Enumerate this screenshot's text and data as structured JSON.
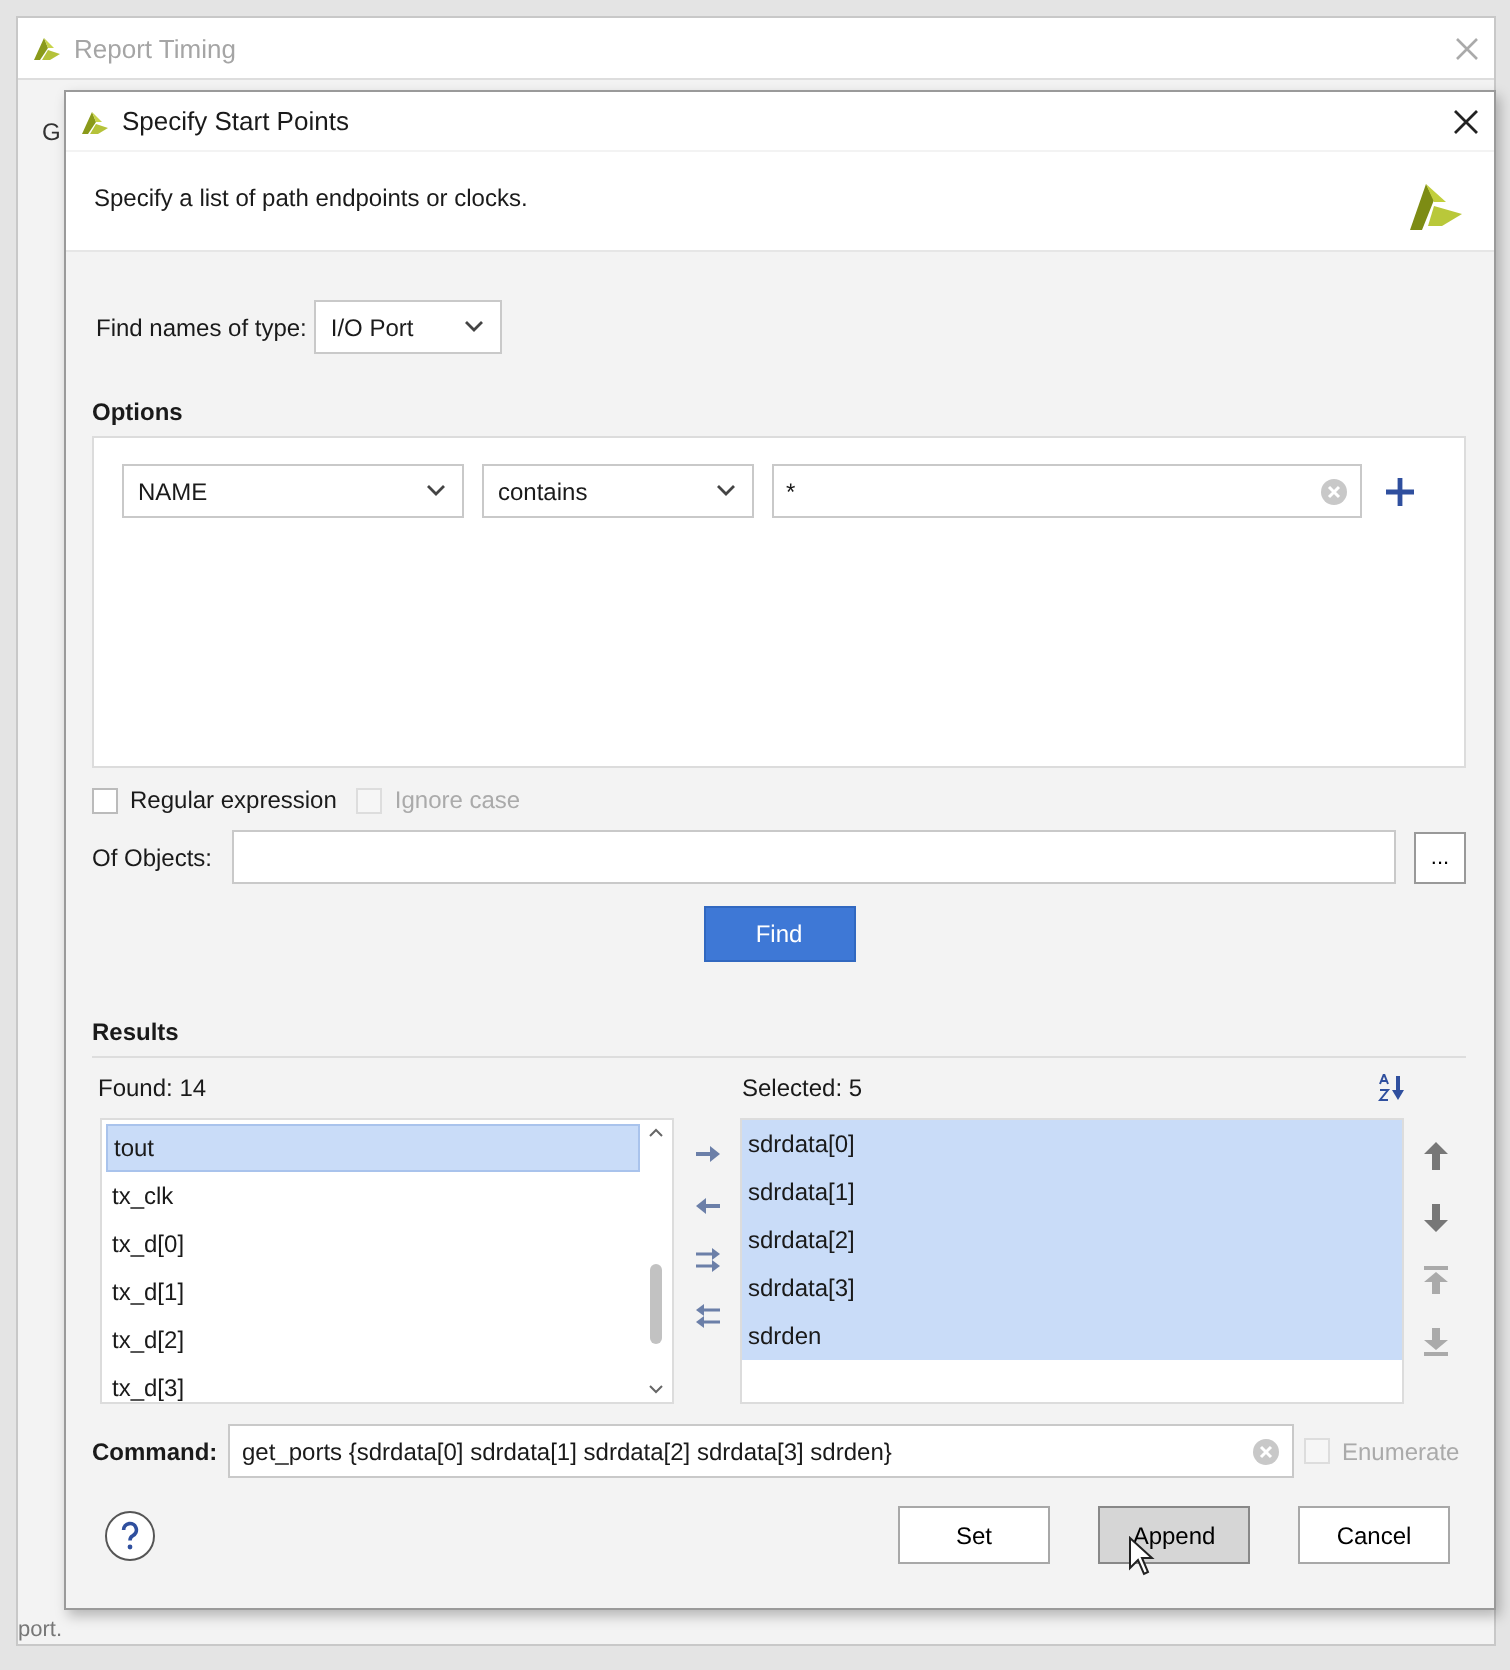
{
  "background_window": {
    "title": "Report Timing",
    "label": "G",
    "footer": "port."
  },
  "dialog": {
    "title": "Specify Start Points",
    "description": "Specify a list of path endpoints or clocks."
  },
  "find_type": {
    "label": "Find names of type:",
    "value": "I/O Port"
  },
  "options": {
    "heading": "Options",
    "filters": [
      {
        "property": "NAME",
        "operator": "contains",
        "value": "*"
      }
    ]
  },
  "checkboxes": [
    {
      "label": "Regular expression",
      "checked": false,
      "disabled": false
    },
    {
      "label": "Ignore case",
      "checked": false,
      "disabled": true
    }
  ],
  "of_objects": {
    "label": "Of Objects:",
    "button": "..."
  },
  "find_button": "Find",
  "results": {
    "heading": "Results",
    "found_label": "Found: 14",
    "selected_label": "Selected: 5",
    "found_items": [
      {
        "label": "tout",
        "selected": true
      },
      {
        "label": "tx_clk",
        "selected": false
      },
      {
        "label": "tx_d[0]",
        "selected": false
      },
      {
        "label": "tx_d[1]",
        "selected": false
      },
      {
        "label": "tx_d[2]",
        "selected": false
      },
      {
        "label": "tx_d[3]",
        "selected": false
      }
    ],
    "selected_items": [
      {
        "label": "sdrdata[0]",
        "selected": true
      },
      {
        "label": "sdrdata[1]",
        "selected": true
      },
      {
        "label": "sdrdata[2]",
        "selected": true
      },
      {
        "label": "sdrdata[3]",
        "selected": true
      },
      {
        "label": "sdrden",
        "selected": true
      }
    ]
  },
  "command": {
    "label": "Command:",
    "value": "get_ports {sdrdata[0] sdrdata[1] sdrdata[2] sdrdata[3] sdrden}"
  },
  "enumerate": {
    "label": "Enumerate",
    "checked": false,
    "disabled": true
  },
  "buttons": [
    {
      "label": "Set",
      "pressed": false
    },
    {
      "label": "Append",
      "pressed": true
    },
    {
      "label": "Cancel",
      "pressed": false
    }
  ]
}
